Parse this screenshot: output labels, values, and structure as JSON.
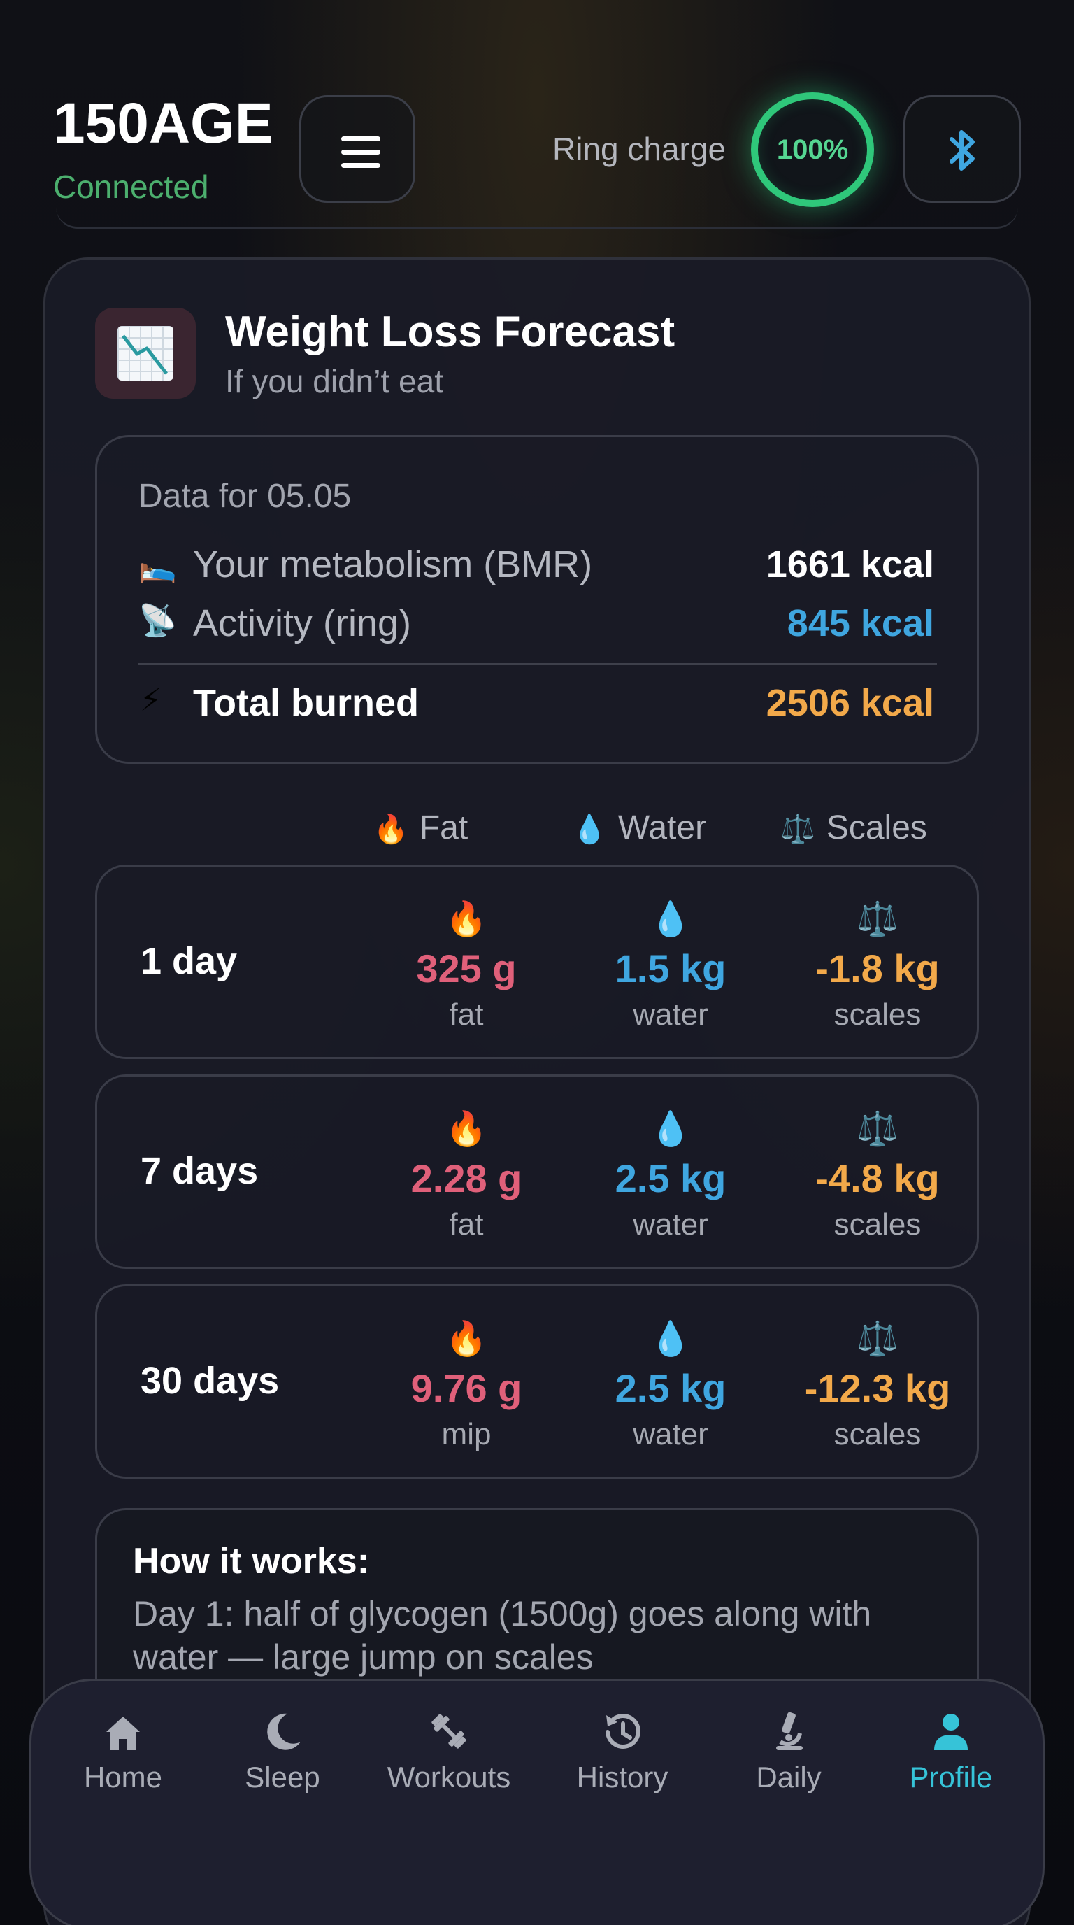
{
  "header": {
    "brand": "150AGE",
    "status": "Connected",
    "ring_label": "Ring charge",
    "ring_percent": "100%",
    "ring_level": 1.0,
    "accent_green": "#2fc77a",
    "bluetooth_icon": "bluetooth-icon",
    "menu_icon": "hamburger-menu-icon"
  },
  "card": {
    "title": "Weight Loss Forecast",
    "subtitle": "If you didn’t eat",
    "icon": "chart-decreasing-icon"
  },
  "data": {
    "date_label": "Data for 05.05",
    "bmr": {
      "icon": "🛌",
      "label": "Your metabolism (BMR)",
      "value": "1661 kcal",
      "color": "#ffffff"
    },
    "activity": {
      "icon": "📡",
      "label": "Activity (ring)",
      "value": "845 kcal",
      "color": "#3fa6e0"
    },
    "total": {
      "icon": "⚡",
      "label": "Total burned",
      "value": "2506 kcal",
      "color": "#f2a94a"
    }
  },
  "columns": {
    "fat": {
      "icon": "🔥",
      "label": "Fat"
    },
    "water": {
      "icon": "💧",
      "label": "Water"
    },
    "scales": {
      "icon": "⚖️",
      "label": "Scales"
    }
  },
  "periods": [
    {
      "label": "1 day",
      "fat": "325 g",
      "fat_unit": "fat",
      "water": "1.5 kg",
      "water_unit": "water",
      "scales": "-1.8 kg",
      "scales_unit": "scales"
    },
    {
      "label": "7 days",
      "fat": "2.28 g",
      "fat_unit": "fat",
      "water": "2.5 kg",
      "water_unit": "water",
      "scales": "-4.8 kg",
      "scales_unit": "scales"
    },
    {
      "label": "30 days",
      "fat": "9.76 g",
      "fat_unit": "mip",
      "water": "2.5 kg",
      "water_unit": "water",
      "scales": "-12.3 kg",
      "scales_unit": "scales"
    }
  ],
  "how": {
    "title": "How it works:",
    "text": "Day 1: half of glycogen (1500g) goes along with water — large jump on scales"
  },
  "nav": {
    "items": [
      {
        "label": "Home",
        "icon": "home-icon"
      },
      {
        "label": "Sleep",
        "icon": "moon-icon"
      },
      {
        "label": "Workouts",
        "icon": "dumbbell-icon"
      },
      {
        "label": "History",
        "icon": "history-icon"
      },
      {
        "label": "Daily",
        "icon": "microscope-icon"
      },
      {
        "label": "Profile",
        "icon": "profile-icon"
      }
    ],
    "active": "Profile",
    "active_color": "#36c3d8"
  }
}
